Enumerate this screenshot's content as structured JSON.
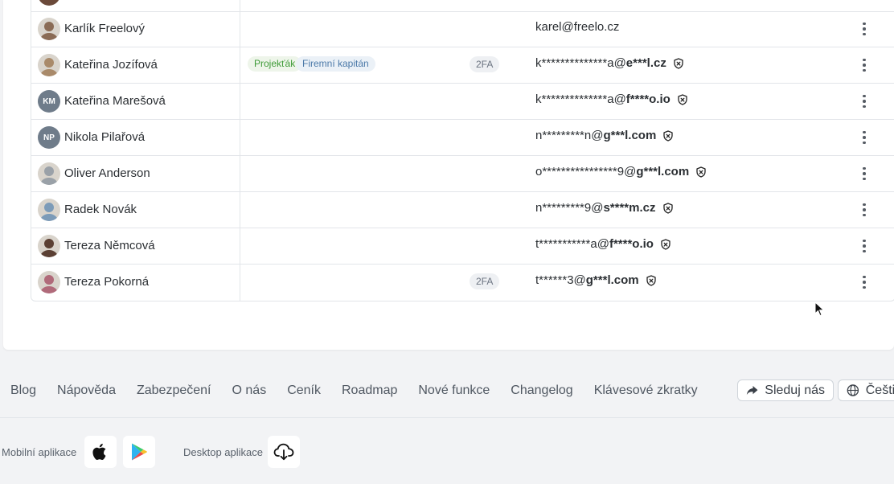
{
  "members": [
    {
      "name": "Karlík Freelový",
      "avatar": {
        "type": "photo",
        "color": "#8a6b55"
      },
      "tags": [],
      "twofa": "",
      "email": {
        "local": "karel@freelo.cz",
        "domain": "",
        "masked": false
      }
    },
    {
      "name": "Kateřina Jozífová",
      "avatar": {
        "type": "photo",
        "color": "#a98a6a"
      },
      "tags": [
        {
          "label": "Projekťák",
          "style": "green"
        },
        {
          "label": "Firemní kapitán",
          "style": "blue"
        }
      ],
      "twofa": "2FA",
      "email": {
        "local": "k**************a@",
        "domain": "e***l.cz",
        "masked": true
      }
    },
    {
      "name": "Kateřina Marešová",
      "avatar": {
        "type": "initials",
        "initials": "KM"
      },
      "tags": [],
      "twofa": "",
      "email": {
        "local": "k**************a@",
        "domain": "f****o.io",
        "masked": true
      }
    },
    {
      "name": "Nikola Pilařová",
      "avatar": {
        "type": "initials",
        "initials": "NP"
      },
      "tags": [],
      "twofa": "",
      "email": {
        "local": "n*********n@",
        "domain": "g***l.com",
        "masked": true
      }
    },
    {
      "name": "Oliver Anderson",
      "avatar": {
        "type": "photo",
        "color": "#9aa1a8"
      },
      "tags": [],
      "twofa": "",
      "email": {
        "local": "o****************9@",
        "domain": "g***l.com",
        "masked": true
      }
    },
    {
      "name": "Radek Novák",
      "avatar": {
        "type": "photo",
        "color": "#7c9bb8"
      },
      "tags": [],
      "twofa": "",
      "email": {
        "local": "n*********9@",
        "domain": "s****m.cz",
        "masked": true
      }
    },
    {
      "name": "Tereza Němcová",
      "avatar": {
        "type": "photo",
        "color": "#5b4034"
      },
      "tags": [],
      "twofa": "",
      "email": {
        "local": "t***********a@",
        "domain": "f****o.io",
        "masked": true
      }
    },
    {
      "name": "Tereza Pokorná",
      "avatar": {
        "type": "photo",
        "color": "#b06a7a"
      },
      "tags": [],
      "twofa": "2FA",
      "email": {
        "local": "t******3@",
        "domain": "g***l.com",
        "masked": true
      }
    }
  ],
  "footer": {
    "links": [
      "Blog",
      "Nápověda",
      "Zabezpečení",
      "O nás",
      "Ceník",
      "Roadmap",
      "Nové funkce",
      "Changelog",
      "Klávesové zkratky"
    ],
    "follow_label": "Sleduj nás",
    "language_label": "Čeština",
    "mobile_apps_label": "Mobilní aplikace",
    "desktop_apps_label": "Desktop aplikace"
  },
  "icons": {
    "row_menu": "more-vertical-icon",
    "email_shield": "shield-x-icon",
    "follow": "share-arrow-icon",
    "language": "globe-icon",
    "ios": "apple-icon",
    "android": "google-play-icon",
    "desktop": "cloud-download-icon"
  }
}
